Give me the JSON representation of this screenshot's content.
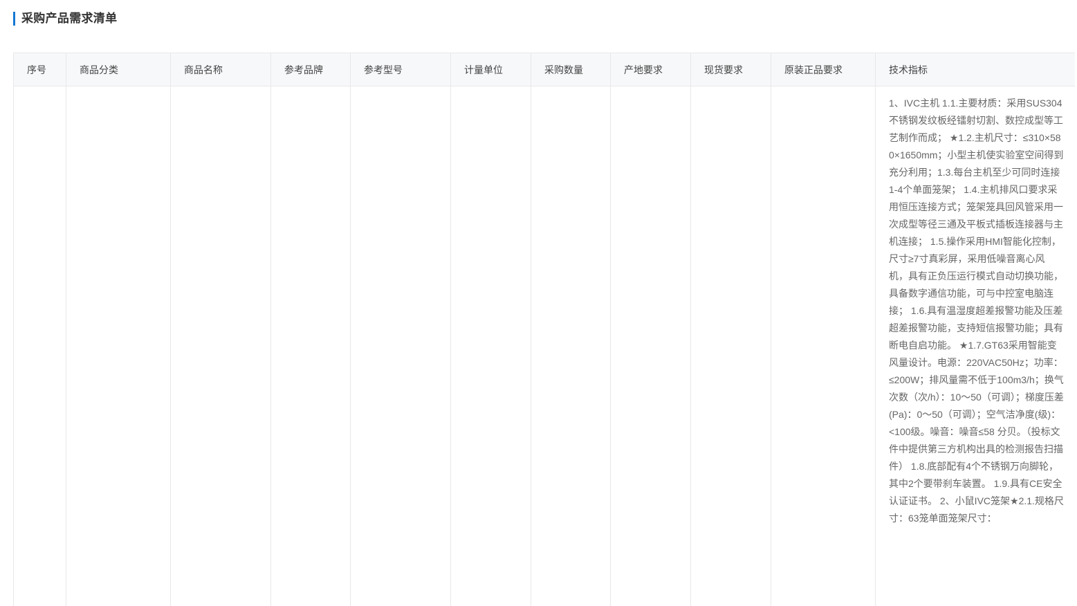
{
  "section": {
    "title": "采购产品需求清单"
  },
  "table": {
    "headers": {
      "index": "序号",
      "category": "商品分类",
      "name": "商品名称",
      "brand": "参考品牌",
      "model": "参考型号",
      "unit": "计量单位",
      "quantity": "采购数量",
      "origin": "产地要求",
      "stock": "现货要求",
      "genuine": "原装正品要求",
      "spec": "技术指标"
    },
    "rows": [
      {
        "index": "",
        "category": "",
        "name": "",
        "brand": "",
        "model": "",
        "unit": "",
        "quantity": "",
        "origin": "",
        "stock": "",
        "genuine": "",
        "spec": "1、IVC主机 1.1.主要材质：采用SUS304不锈钢发纹板经镭射切割、数控成型等工艺制作而成； ★1.2.主机尺寸：≤310×580×1650mm；小型主机使实验室空间得到充分利用；1.3.每台主机至少可同时连接1-4个单面笼架； 1.4.主机排风口要求采用恒压连接方式；笼架笼具回风管采用一次成型等径三通及平板式插板连接器与主机连接； 1.5.操作采用HMI智能化控制，尺寸≥7寸真彩屏，采用低噪音离心风机，具有正负压运行模式自动切换功能，具备数字通信功能，可与中控室电脑连接； 1.6.具有温湿度超差报警功能及压差超差报警功能，支持短信报警功能；具有断电自启功能。 ★1.7.GT63采用智能变风量设计。电源：220VAC50Hz；功率：≤200W；排风量需不低于100m3/h；换气次数（次/h）：10～50（可调）；梯度压差(Pa)：0～50（可调）；空气洁净度(级)：<100级。噪音：噪音≤58 分贝。（投标文件中提供第三方机构出具的检测报告扫描件） 1.8.底部配有4个不锈钢万向脚轮，其中2个要带刹车装置。 1.9.具有CE安全认证证书。 2、小鼠IVC笼架★2.1.规格尺寸：63笼单面笼架尺寸："
      }
    ]
  },
  "colors": {
    "accent": "#1677d2",
    "header_bg": "#f7f8fa",
    "border": "#e8e8e8"
  }
}
